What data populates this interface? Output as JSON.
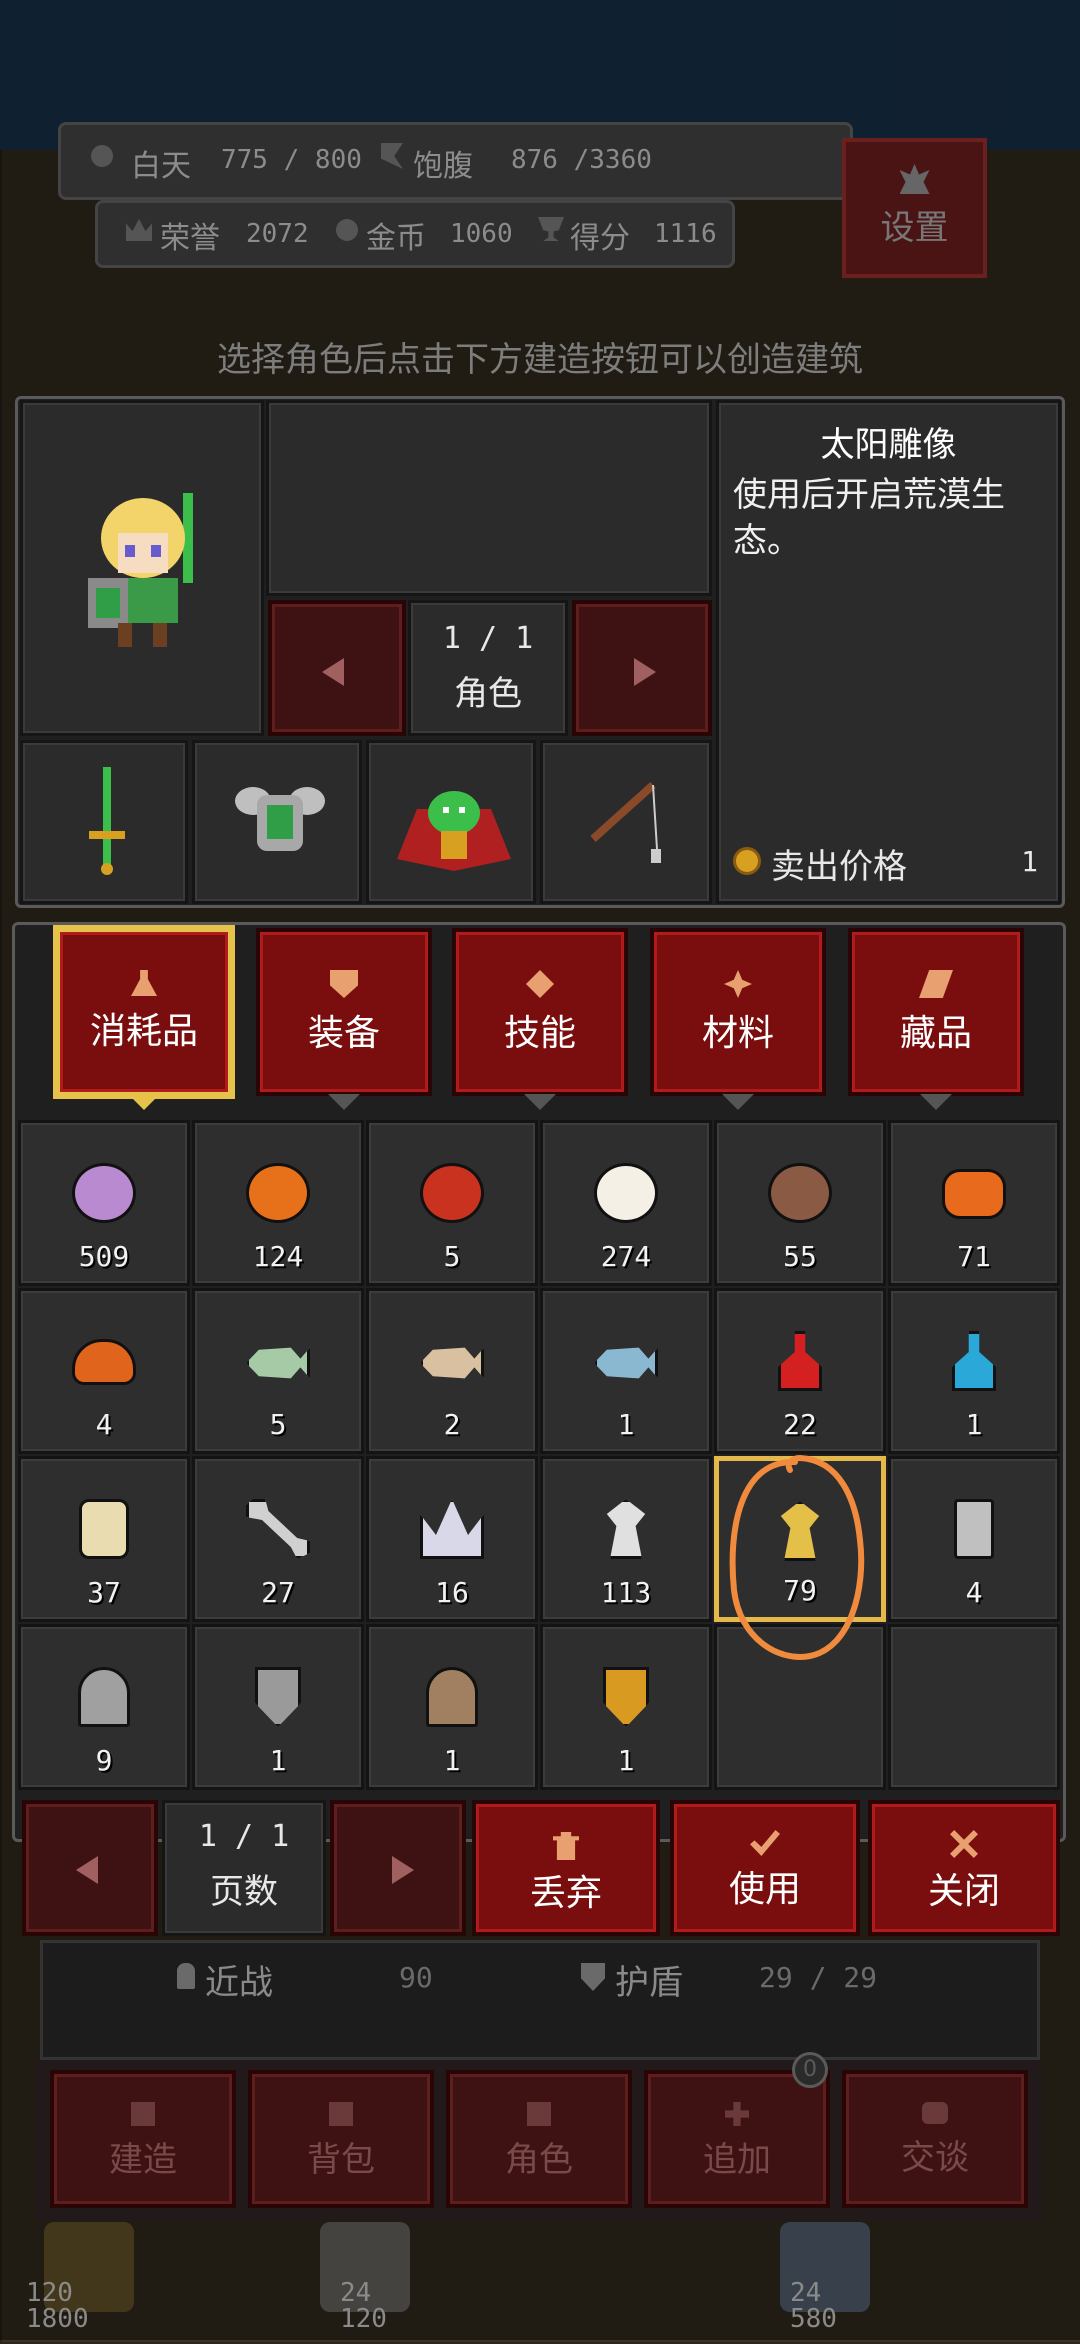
{
  "hud": {
    "day_label": "白天",
    "day_value": "775 / 800",
    "hunger_label": "饱腹",
    "hunger_value": "876 /3360",
    "honor_label": "荣誉",
    "honor_value": "2072",
    "gold_label": "金币",
    "gold_value": "1060",
    "score_label": "得分",
    "score_value": "1116",
    "settings_label": "设置"
  },
  "hint": "选择角色后点击下方建造按钮可以创造建筑",
  "character": {
    "page": "1 / 1",
    "label": "角色"
  },
  "item_info": {
    "name": "太阳雕像",
    "description": "使用后开启荒漠生态。",
    "sell_label": "卖出价格",
    "sell_price": "1"
  },
  "tabs": [
    {
      "label": "消耗品",
      "icon": "flask-icon",
      "active": true
    },
    {
      "label": "装备",
      "icon": "shield-icon",
      "active": false
    },
    {
      "label": "技能",
      "icon": "diamond-icon",
      "active": false
    },
    {
      "label": "材料",
      "icon": "gem-icon",
      "active": false
    },
    {
      "label": "藏品",
      "icon": "scroll-icon",
      "active": false
    }
  ],
  "items": [
    {
      "icon": "turnip-icon",
      "count": "509",
      "color": "#b98ad0"
    },
    {
      "icon": "pumpkin-icon",
      "count": "124",
      "color": "#e7711b"
    },
    {
      "icon": "berries-icon",
      "count": "5",
      "color": "#c8321e"
    },
    {
      "icon": "fried-egg-icon",
      "count": "274",
      "color": "#f4f0e6"
    },
    {
      "icon": "soup-bowl-icon",
      "count": "55",
      "color": "#8a5a44"
    },
    {
      "icon": "cake-icon",
      "count": "71",
      "color": "#e86a1c"
    },
    {
      "icon": "burger-icon",
      "count": "4",
      "color": "#e0641c"
    },
    {
      "icon": "fish-green-icon",
      "count": "5",
      "color": "#a6c9a6"
    },
    {
      "icon": "fish-tan-icon",
      "count": "2",
      "color": "#d8c0a0"
    },
    {
      "icon": "fish-blue-icon",
      "count": "1",
      "color": "#8ab8d0"
    },
    {
      "icon": "red-potion-icon",
      "count": "22",
      "color": "#d42020"
    },
    {
      "icon": "blue-potion-icon",
      "count": "1",
      "color": "#2aa8d8"
    },
    {
      "icon": "jar-icon",
      "count": "37",
      "color": "#e8dcb0"
    },
    {
      "icon": "bone-icon",
      "count": "27",
      "color": "#d0d0d0"
    },
    {
      "icon": "crown-icon",
      "count": "16",
      "color": "#d8d8e8"
    },
    {
      "icon": "winged-statue-icon",
      "count": "113",
      "color": "#e0e0e0"
    },
    {
      "icon": "sun-statue-icon",
      "count": "79",
      "color": "#e4c048",
      "selected": true
    },
    {
      "icon": "card-icon",
      "count": "4",
      "color": "#c0c0c0"
    },
    {
      "icon": "tombstone-green-icon",
      "count": "9",
      "color": "#a0a0a0"
    },
    {
      "icon": "shield-gray-icon",
      "count": "1",
      "color": "#9a9a9a"
    },
    {
      "icon": "tombstone-blue-icon",
      "count": "1",
      "color": "#a08060"
    },
    {
      "icon": "shield-gold-icon",
      "count": "1",
      "color": "#d89a20"
    },
    {
      "icon": "",
      "count": ""
    },
    {
      "icon": "",
      "count": ""
    }
  ],
  "bottom": {
    "page": "1 / 1",
    "page_label": "页数",
    "discard_label": "丢弃",
    "use_label": "使用",
    "close_label": "关闭"
  },
  "stats": {
    "melee_label": "近战",
    "melee_value": "90",
    "shield_label": "护盾",
    "shield_value": "29 / 29"
  },
  "menu": {
    "build": "建造",
    "bag": "背包",
    "role": "角色",
    "add": "追加",
    "talk": "交谈",
    "badge": "0"
  },
  "units": [
    {
      "top": "120",
      "bottom": "1800"
    },
    {
      "top": "24",
      "bottom": "120"
    },
    {
      "top": "24",
      "bottom": "580"
    }
  ]
}
